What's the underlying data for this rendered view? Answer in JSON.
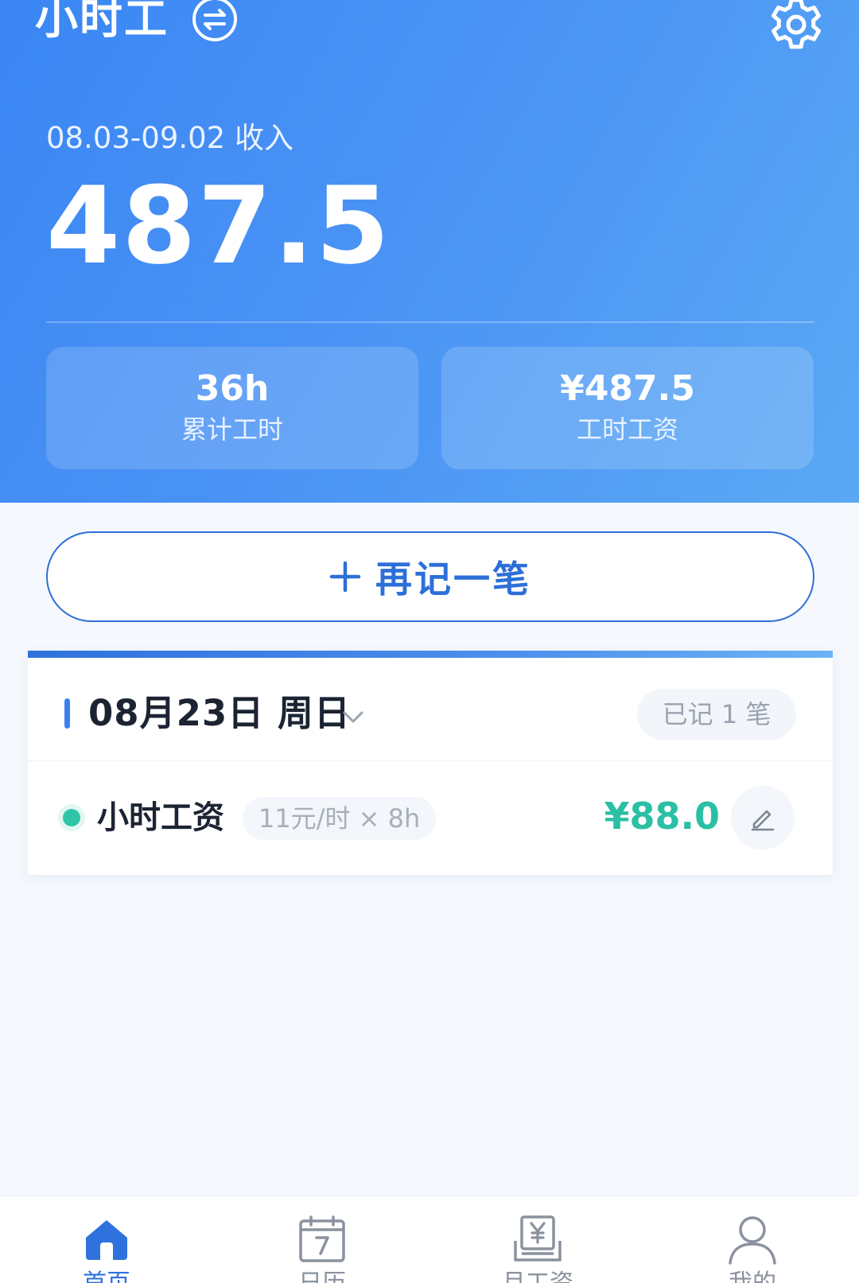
{
  "header": {
    "app_title": "小时工",
    "period_label": "08.03-09.02 收入",
    "total_income": "487.5",
    "stats": [
      {
        "value": "36h",
        "label": "累计工时"
      },
      {
        "value": "¥487.5",
        "label": "工时工资"
      }
    ],
    "icons": {
      "switch": "switch-arrows-icon",
      "settings": "gear-icon"
    }
  },
  "actions": {
    "add_record_label": "再记一笔"
  },
  "record": {
    "date_label": "08月23日 周日",
    "count_badge": "已记 1 笔",
    "entries": [
      {
        "name": "小时工资",
        "rate_detail": "11元/时 × 8h",
        "amount": "¥88.0",
        "dot_color": "#2fc4a8"
      }
    ]
  },
  "bottom_nav": {
    "active_index": 0,
    "items": [
      {
        "label": "首页",
        "icon": "home-icon"
      },
      {
        "label": "日历",
        "icon": "calendar-icon"
      },
      {
        "label": "月工资",
        "icon": "payroll-icon"
      },
      {
        "label": "我的",
        "icon": "profile-icon"
      }
    ]
  },
  "colors": {
    "brand_blue": "#3a86f4",
    "accent_green": "#2bbfa4",
    "text_dark": "#1c2433",
    "muted": "#9aa3b1"
  }
}
